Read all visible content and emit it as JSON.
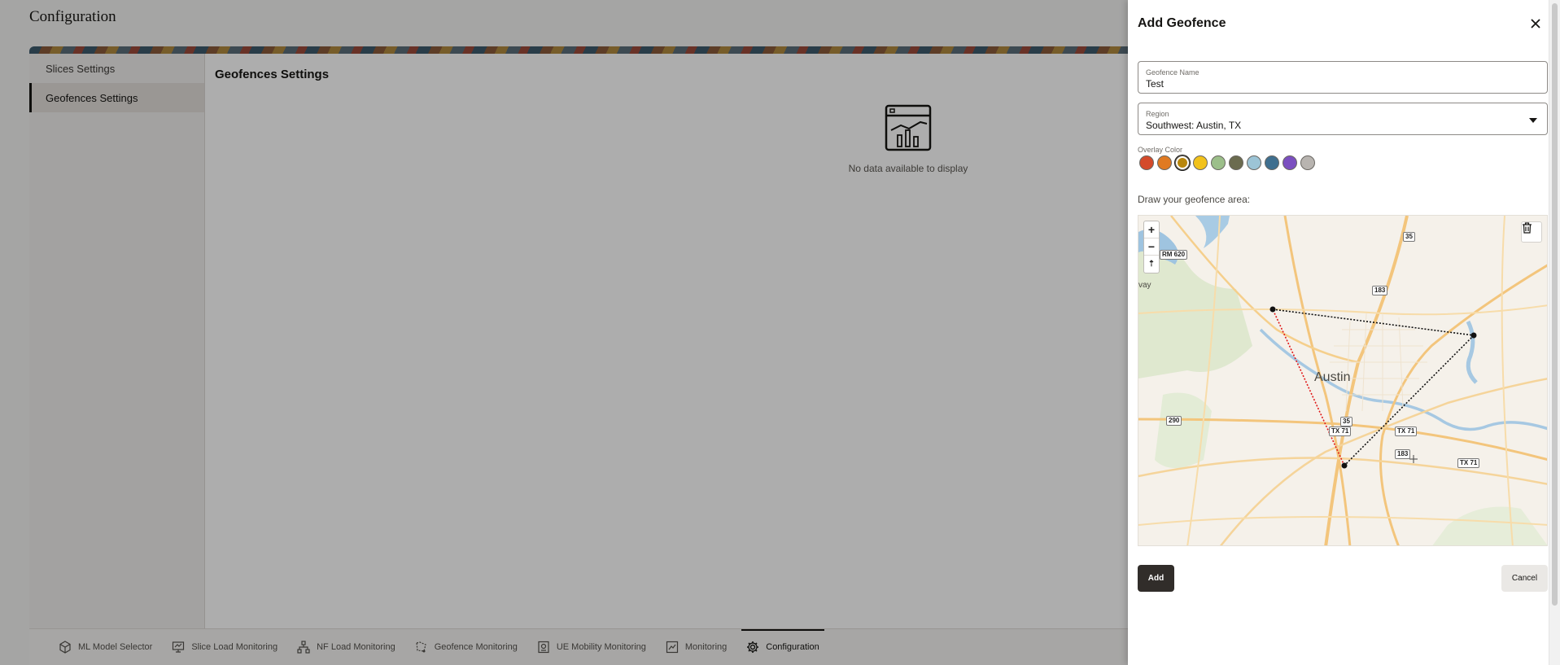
{
  "page": {
    "title": "Configuration",
    "side_nav": [
      {
        "label": "Slices Settings",
        "active": false
      },
      {
        "label": "Geofences Settings",
        "active": true
      }
    ],
    "section_title": "Geofences Settings",
    "empty_state": {
      "text": "No data available to display",
      "icon": "chart-doc-icon"
    },
    "bottom_tabs": [
      {
        "label": "ML Model Selector",
        "icon": "cube-icon"
      },
      {
        "label": "Slice Load Monitoring",
        "icon": "monitor-icon"
      },
      {
        "label": "NF Load Monitoring",
        "icon": "network-icon"
      },
      {
        "label": "Geofence Monitoring",
        "icon": "geofence-icon"
      },
      {
        "label": "UE Mobility Monitoring",
        "icon": "mobile-icon"
      },
      {
        "label": "Monitoring",
        "icon": "chart-icon"
      },
      {
        "label": "Configuration",
        "icon": "gear-icon",
        "active": true
      }
    ]
  },
  "drawer": {
    "title": "Add Geofence",
    "geofence_name": {
      "label": "Geofence Name",
      "value": "Test"
    },
    "region": {
      "label": "Region",
      "value": "Southwest: Austin, TX"
    },
    "overlay_color": {
      "label": "Overlay Color",
      "colors": [
        "#d44a2a",
        "#e07a22",
        "#b8860b",
        "#f2c21b",
        "#9cbf8a",
        "#6b6b4f",
        "#9cc4d6",
        "#3f6f8f",
        "#7b4fc0",
        "#b8b4b0"
      ],
      "selected_index": 2
    },
    "draw_label": "Draw your geofence area:",
    "map": {
      "city_label": "Austin",
      "place_label": "vay",
      "route_labels": [
        "RM 620",
        "35",
        "183",
        "290",
        "35",
        "TX 71",
        "TX 71",
        "183",
        "TX 71"
      ],
      "zoom_in": "+",
      "zoom_out": "−",
      "reset_north": "⇡"
    },
    "add_label": "Add",
    "cancel_label": "Cancel"
  }
}
